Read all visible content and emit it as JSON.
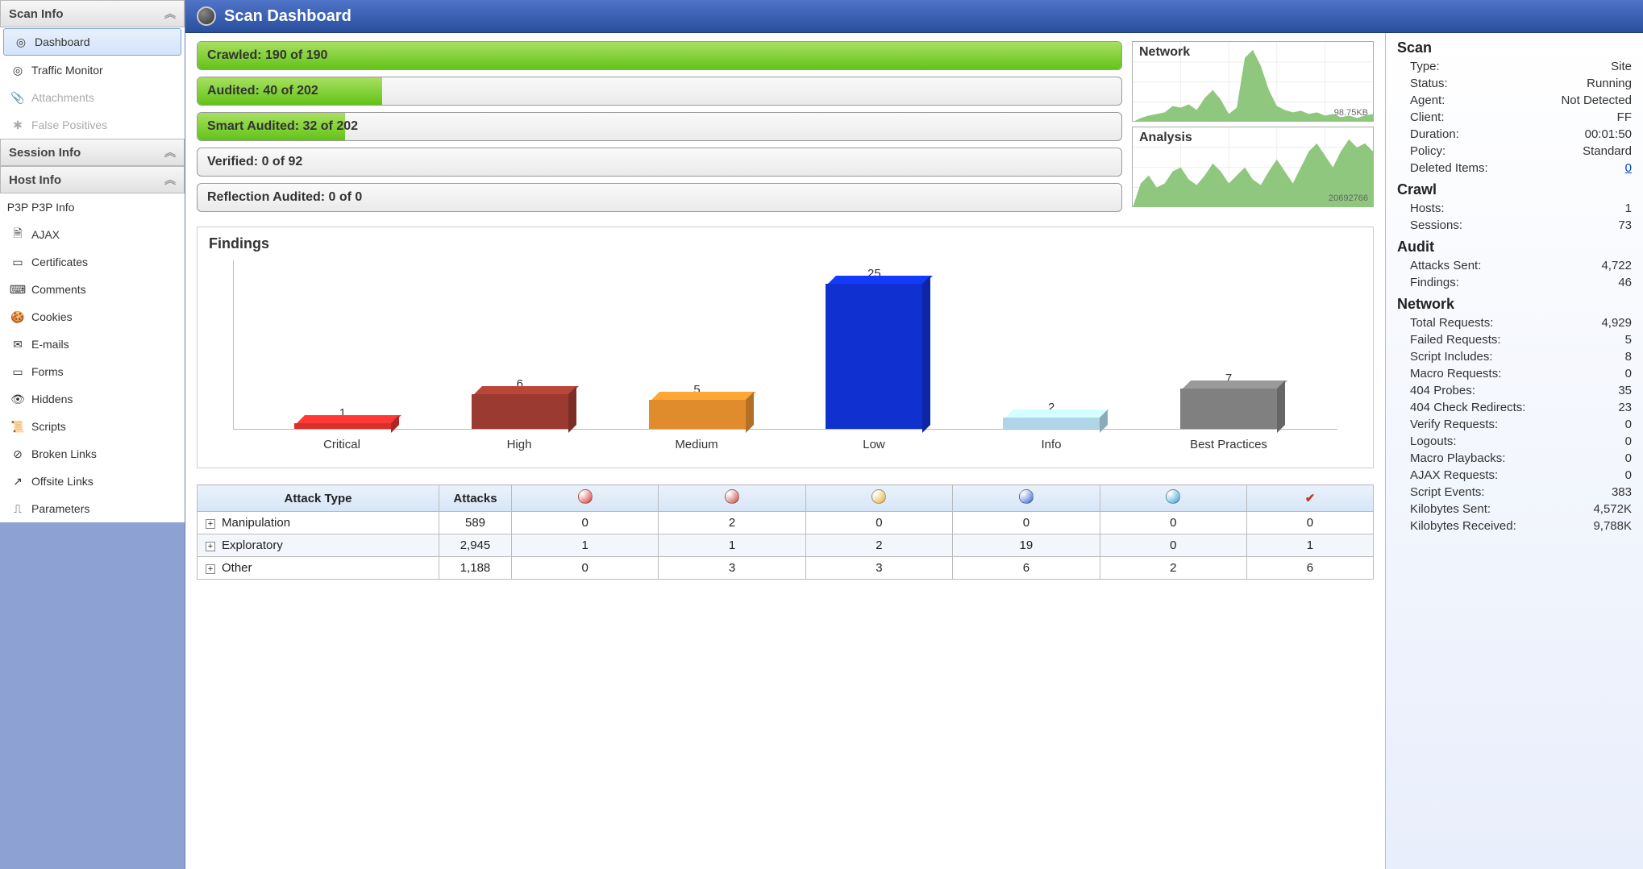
{
  "sidebar": {
    "sections": [
      {
        "title": "Scan Info",
        "items": [
          {
            "label": "Dashboard",
            "icon": "◎",
            "active": true,
            "name": "sidebar-item-dashboard"
          },
          {
            "label": "Traffic Monitor",
            "icon": "◎",
            "name": "sidebar-item-traffic-monitor"
          },
          {
            "label": "Attachments",
            "icon": "📎",
            "disabled": true,
            "name": "sidebar-item-attachments"
          },
          {
            "label": "False Positives",
            "icon": "✱",
            "disabled": true,
            "name": "sidebar-item-false-positives"
          }
        ]
      },
      {
        "title": "Session Info",
        "items": []
      },
      {
        "title": "Host Info",
        "items": [
          {
            "label": "P3P Info",
            "icon": "P3P",
            "name": "sidebar-item-p3p-info"
          },
          {
            "label": "AJAX",
            "icon": "🗎",
            "name": "sidebar-item-ajax"
          },
          {
            "label": "Certificates",
            "icon": "▭",
            "name": "sidebar-item-certificates"
          },
          {
            "label": "Comments",
            "icon": "⌨",
            "name": "sidebar-item-comments"
          },
          {
            "label": "Cookies",
            "icon": "🍪",
            "name": "sidebar-item-cookies"
          },
          {
            "label": "E-mails",
            "icon": "✉",
            "name": "sidebar-item-emails"
          },
          {
            "label": "Forms",
            "icon": "▭",
            "name": "sidebar-item-forms"
          },
          {
            "label": "Hiddens",
            "icon": "👁",
            "name": "sidebar-item-hiddens"
          },
          {
            "label": "Scripts",
            "icon": "📜",
            "name": "sidebar-item-scripts"
          },
          {
            "label": "Broken Links",
            "icon": "⊘",
            "name": "sidebar-item-broken-links"
          },
          {
            "label": "Offsite Links",
            "icon": "↗",
            "name": "sidebar-item-offsite-links"
          },
          {
            "label": "Parameters",
            "icon": "⎍",
            "name": "sidebar-item-parameters"
          }
        ]
      }
    ]
  },
  "title": "Scan Dashboard",
  "progress": [
    {
      "label": "Crawled: 190 of 190",
      "pct": 100
    },
    {
      "label": "Audited: 40 of 202",
      "pct": 20
    },
    {
      "label": "Smart Audited: 32 of 202",
      "pct": 16
    },
    {
      "label": "Verified: 0 of 92",
      "pct": 0
    },
    {
      "label": "Reflection Audited: 0 of 0",
      "pct": 0
    }
  ],
  "minicharts": {
    "network": {
      "title": "Network",
      "value": "98.75KB"
    },
    "analysis": {
      "title": "Analysis",
      "value": "20692766"
    }
  },
  "chart_data": {
    "type": "bar",
    "title": "Findings",
    "categories": [
      "Critical",
      "High",
      "Medium",
      "Low",
      "Info",
      "Best Practices"
    ],
    "values": [
      1,
      6,
      5,
      25,
      2,
      7
    ],
    "colors": [
      "#d9302c",
      "#9b3a30",
      "#e08b2c",
      "#1030d0",
      "#b0d5e6",
      "#808080"
    ],
    "ylim": [
      0,
      25
    ]
  },
  "attack_table": {
    "headers": [
      "Attack Type",
      "Attacks",
      "crit",
      "high",
      "med",
      "low",
      "info",
      "flag"
    ],
    "header_colors": [
      "",
      "",
      "#d9302c",
      "#c84038",
      "#e0b030",
      "#3060d0",
      "#30a0d0",
      ""
    ],
    "rows": [
      {
        "type": "Manipulation",
        "attacks": "589",
        "vals": [
          "0",
          "2",
          "0",
          "0",
          "0",
          "0"
        ]
      },
      {
        "type": "Exploratory",
        "attacks": "2,945",
        "vals": [
          "1",
          "1",
          "2",
          "19",
          "0",
          "1"
        ]
      },
      {
        "type": "Other",
        "attacks": "1,188",
        "vals": [
          "0",
          "3",
          "3",
          "6",
          "2",
          "6"
        ]
      }
    ]
  },
  "rightpanel": [
    {
      "head": "Scan",
      "rows": [
        {
          "k": "Type:",
          "v": "Site"
        },
        {
          "k": "Status:",
          "v": "Running"
        },
        {
          "k": "Agent:",
          "v": "Not Detected"
        },
        {
          "k": "Client:",
          "v": "FF"
        },
        {
          "k": "Duration:",
          "v": "00:01:50"
        },
        {
          "k": "Policy:",
          "v": "Standard"
        },
        {
          "k": "Deleted Items:",
          "v": "0",
          "link": true
        }
      ]
    },
    {
      "head": "Crawl",
      "rows": [
        {
          "k": "Hosts:",
          "v": "1"
        },
        {
          "k": "Sessions:",
          "v": "73"
        }
      ]
    },
    {
      "head": "Audit",
      "rows": [
        {
          "k": "Attacks Sent:",
          "v": "4,722"
        },
        {
          "k": "Findings:",
          "v": "46"
        }
      ]
    },
    {
      "head": "Network",
      "rows": [
        {
          "k": "Total Requests:",
          "v": "4,929"
        },
        {
          "k": "Failed Requests:",
          "v": "5"
        },
        {
          "k": "Script Includes:",
          "v": "8"
        },
        {
          "k": "Macro Requests:",
          "v": "0"
        },
        {
          "k": "404 Probes:",
          "v": "35"
        },
        {
          "k": "404 Check Redirects:",
          "v": "23"
        },
        {
          "k": "Verify Requests:",
          "v": "0"
        },
        {
          "k": "Logouts:",
          "v": "0"
        },
        {
          "k": "Macro Playbacks:",
          "v": "0"
        },
        {
          "k": "AJAX Requests:",
          "v": "0"
        },
        {
          "k": "Script Events:",
          "v": "383"
        },
        {
          "k": "Kilobytes Sent:",
          "v": "4,572K"
        },
        {
          "k": "Kilobytes Received:",
          "v": "9,788K"
        }
      ]
    }
  ]
}
